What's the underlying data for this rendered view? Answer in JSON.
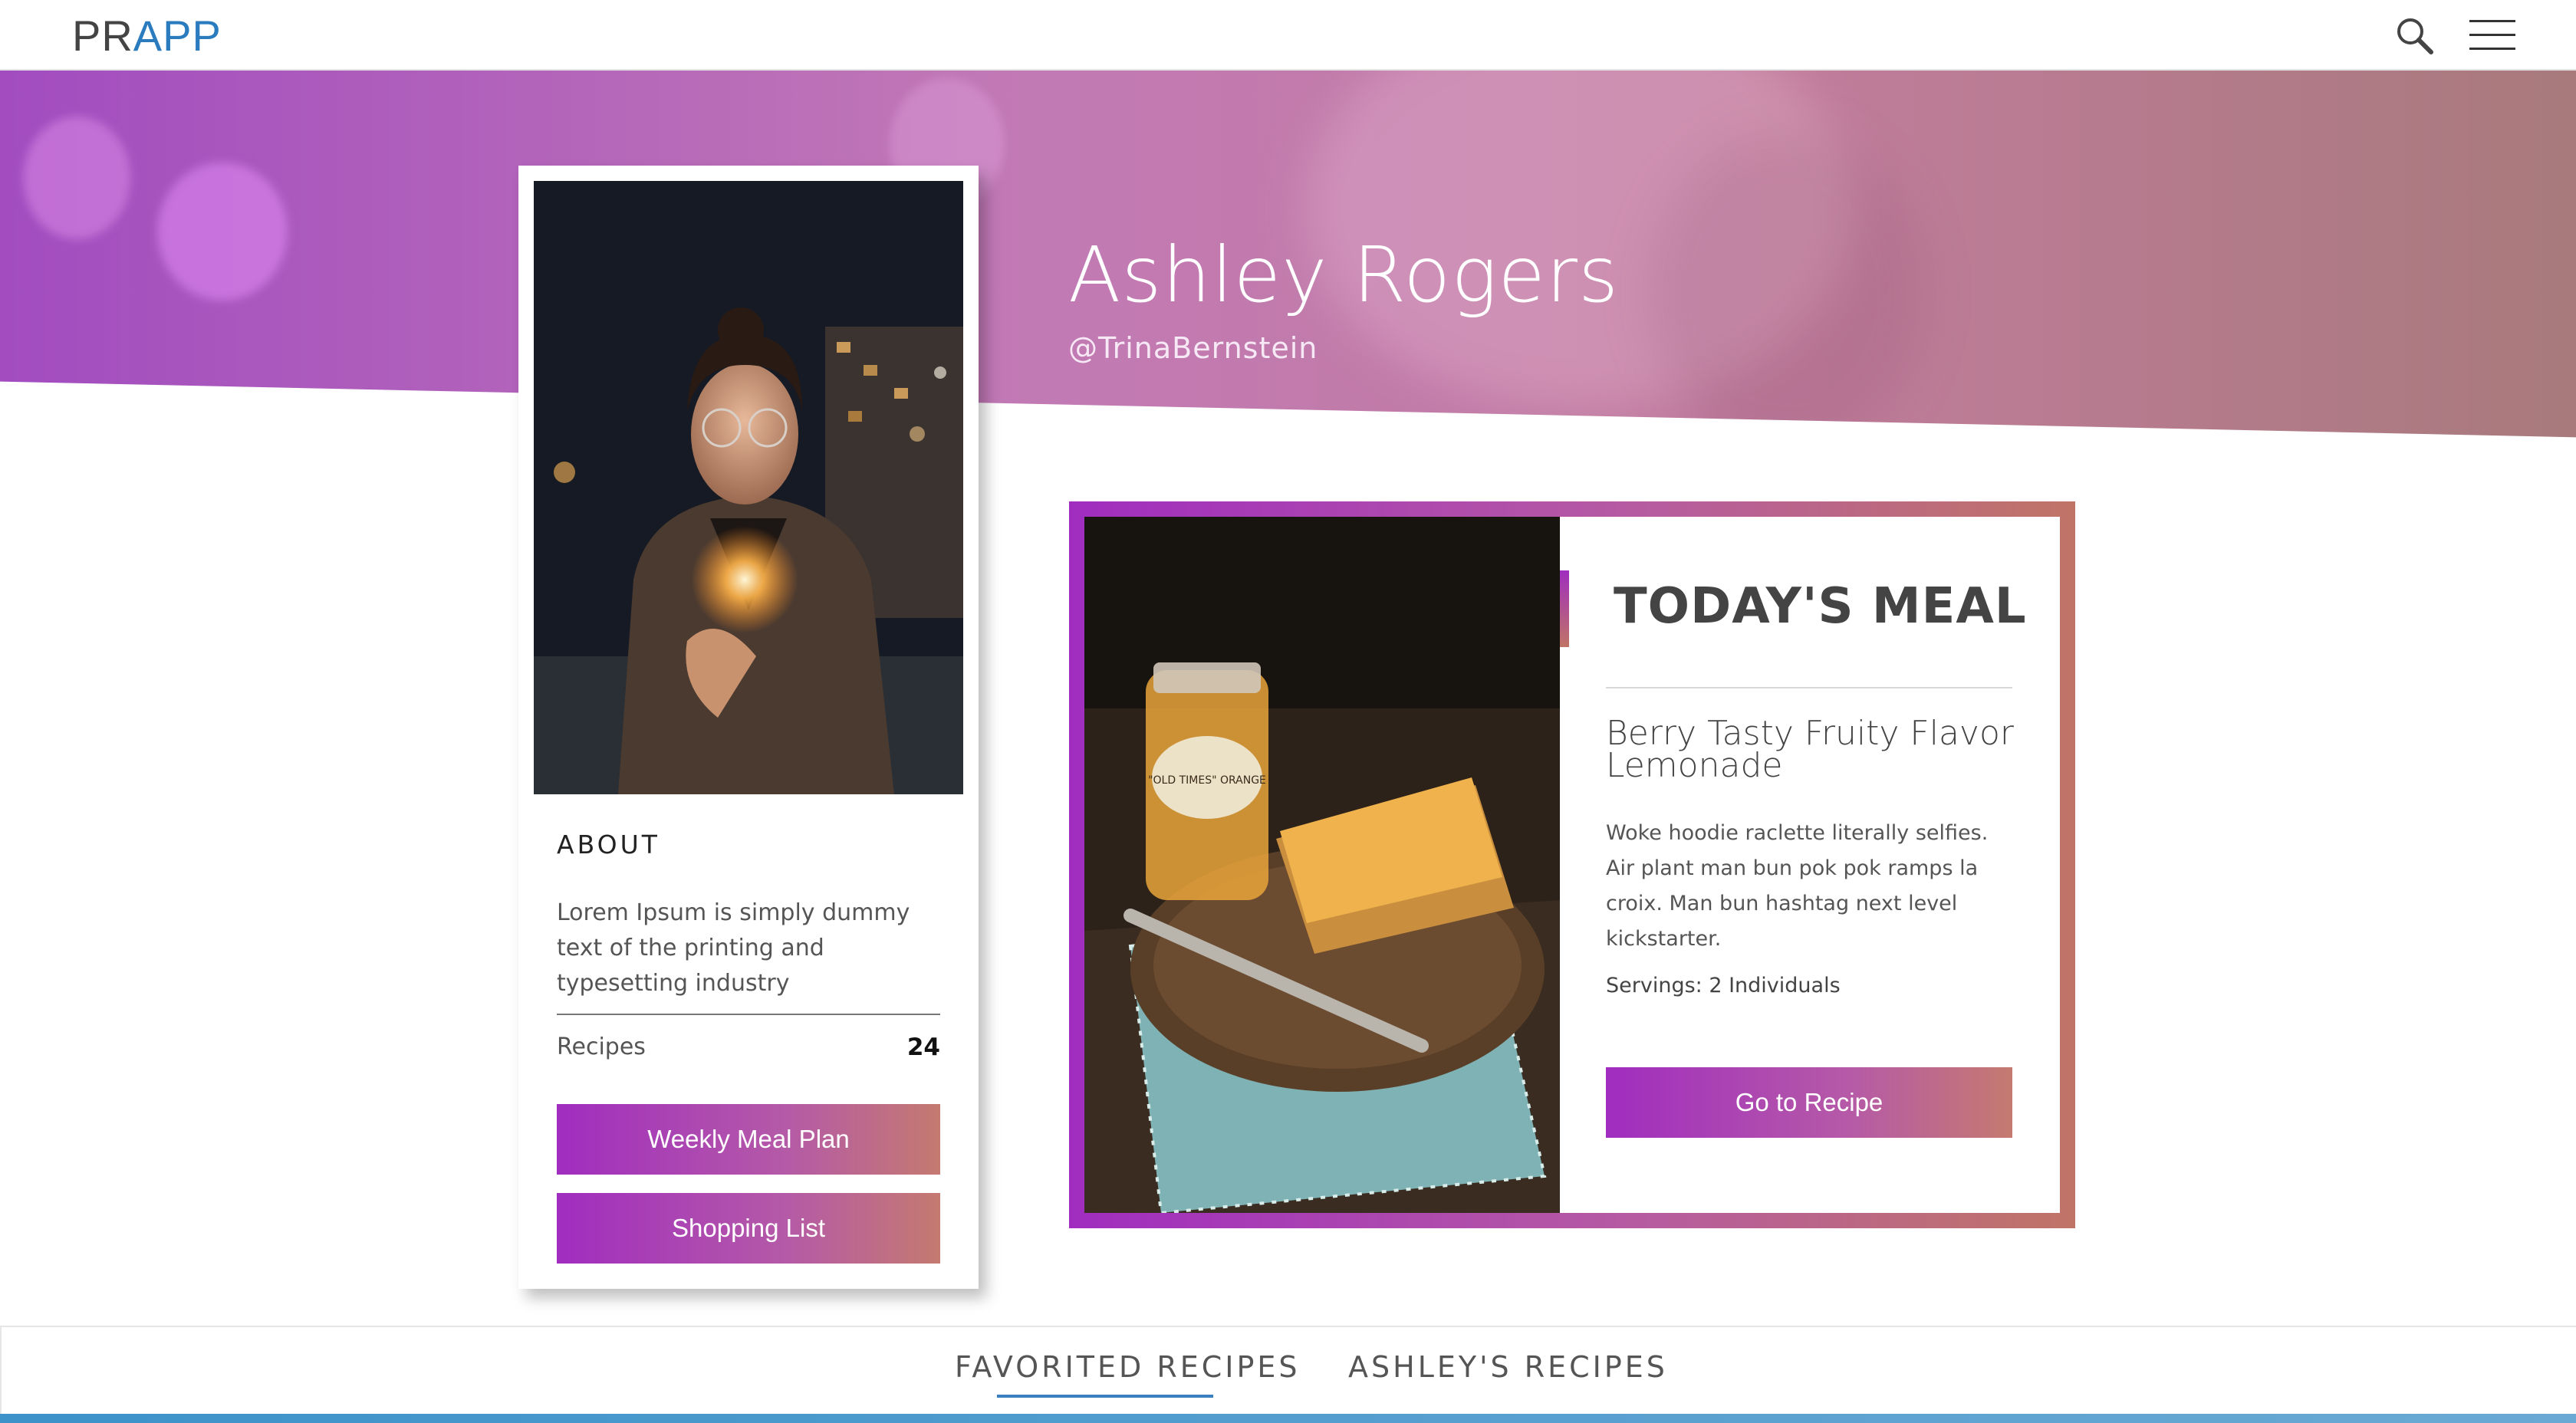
{
  "brand": {
    "logo_part1": "PR",
    "logo_part2": "APP"
  },
  "nav": {
    "search_icon": "search-icon",
    "menu_icon": "hamburger-menu-icon"
  },
  "profile": {
    "name": "Ashley Rogers",
    "handle": "@TrinaBernstein",
    "about_heading": "ABOUT",
    "about_text": "Lorem Ipsum is simply dummy text of the printing and typesetting industry",
    "recipes_label": "Recipes",
    "recipes_count": "24",
    "buttons": {
      "weekly_meal_plan": "Weekly Meal Plan",
      "shopping_list": "Shopping List"
    }
  },
  "todays_meal": {
    "heading": "TODAY'S MEAL",
    "title": "Berry Tasty Fruity Flavor Lemonade",
    "description": "Woke hoodie raclette literally selfies. Air plant man bun pok pok ramps la croix. Man bun hashtag next level kickstarter.",
    "servings": "Servings: 2 Individuals",
    "button": "Go to Recipe",
    "jar_label": "\"OLD TIMES\" ORANGE"
  },
  "tabs": [
    {
      "label": "FAVORITED RECIPES",
      "active": true
    },
    {
      "label": "ASHLEY'S RECIPES",
      "active": false
    }
  ],
  "colors": {
    "accent_purple": "#a02dbf",
    "accent_rose": "#c47a70",
    "link_blue": "#2b7bbf"
  }
}
